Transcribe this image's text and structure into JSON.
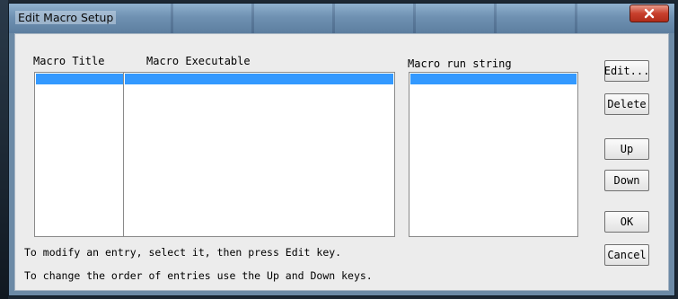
{
  "window": {
    "title": "Edit Macro Setup",
    "close_icon": "close-icon"
  },
  "columns": {
    "macro_title": "Macro Title",
    "macro_executable": "Macro Executable",
    "macro_run_string": "Macro run string"
  },
  "buttons": {
    "edit": "Edit...",
    "delete": "Delete",
    "up": "Up",
    "down": "Down",
    "ok": "OK",
    "cancel": "Cancel"
  },
  "hints": {
    "line1": "To modify an entry, select it, then press Edit key.",
    "line2": "To change the order of entries use the Up and Down keys."
  },
  "colors": {
    "selection": "#3399ff",
    "close_button": "#c8402d"
  }
}
